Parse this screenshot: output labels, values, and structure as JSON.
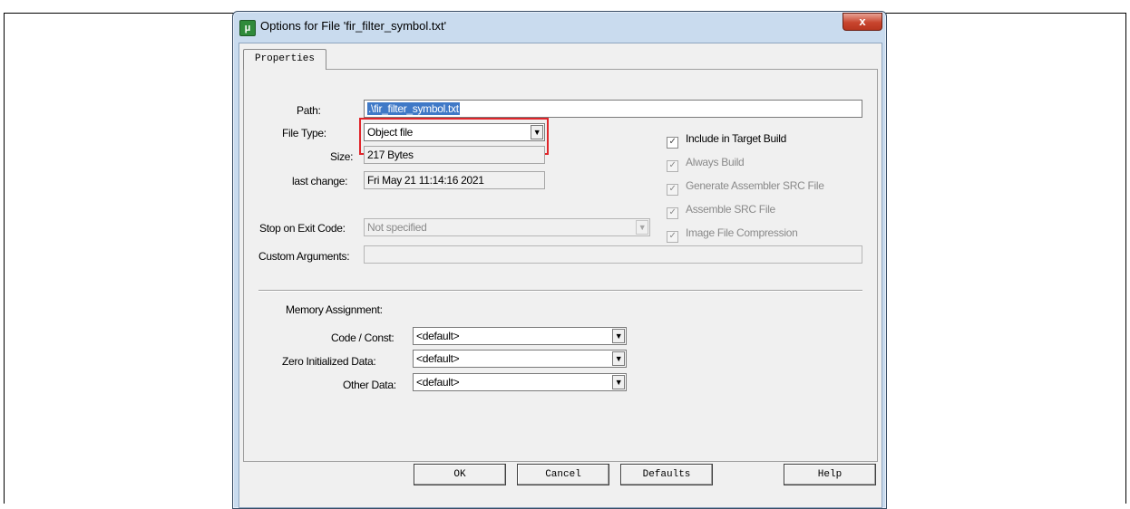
{
  "dialog": {
    "title": "Options for File 'fir_filter_symbol.txt'",
    "app_icon_glyph": "μ",
    "close_glyph": "x"
  },
  "tabs": [
    {
      "label": "Properties"
    }
  ],
  "properties": {
    "path_label": "Path:",
    "path_value": ".\\fir_filter_symbol.txt",
    "file_type_label": "File Type:",
    "file_type_value": "Object file",
    "size_label": "Size:",
    "size_value": "217 Bytes",
    "last_change_label": "last change:",
    "last_change_value": "Fri May 21 11:14:16 2021",
    "stop_exit_label": "Stop on Exit Code:",
    "stop_exit_value": "Not specified",
    "custom_args_label": "Custom Arguments:",
    "custom_args_value": ""
  },
  "options": [
    {
      "label": "Include in Target Build",
      "checked": true,
      "enabled": true
    },
    {
      "label": "Always Build",
      "checked": true,
      "enabled": false
    },
    {
      "label": "Generate Assembler SRC File",
      "checked": true,
      "enabled": false
    },
    {
      "label": "Assemble SRC File",
      "checked": true,
      "enabled": false
    },
    {
      "label": "Image File Compression",
      "checked": true,
      "enabled": false
    }
  ],
  "memory": {
    "heading": "Memory Assignment:",
    "code_const_label": "Code / Const:",
    "code_const_value": "<default>",
    "zero_init_label": "Zero Initialized Data:",
    "zero_init_value": "<default>",
    "other_label": "Other Data:",
    "other_value": "<default>"
  },
  "buttons": {
    "ok": "OK",
    "cancel": "Cancel",
    "defaults": "Defaults",
    "help": "Help"
  },
  "check_glyph": "✓",
  "dropdown_glyph": "▼",
  "colors": {
    "highlight_box": "#e0262b",
    "title_bar": "#c9dbee",
    "selection": "#3f79c7"
  }
}
